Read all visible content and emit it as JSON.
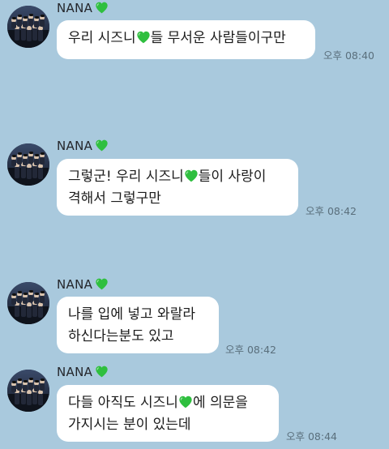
{
  "colors": {
    "background": "#a9c9dd",
    "bubble": "#ffffff",
    "heart": "#2fbf3f"
  },
  "messages": [
    {
      "sender": "NANA",
      "lines": [
        [
          "우리 시즈니",
          "heart",
          "들 무서운 사람들이구만"
        ]
      ],
      "time": "오후 08:40"
    },
    {
      "sender": "NANA",
      "lines": [
        [
          "그렇군! 우리 시즈니",
          "heart",
          "들이 사랑이"
        ],
        [
          "격해서 그렇구만"
        ]
      ],
      "time": "오후 08:42"
    },
    {
      "sender": "NANA",
      "lines": [
        [
          "나를 입에 넣고 와랄라"
        ],
        [
          "하신다는분도 있고"
        ]
      ],
      "time": "오후 08:42"
    },
    {
      "sender": "NANA",
      "lines": [
        [
          "다들 아직도 시즈니",
          "heart",
          "에 의문을"
        ],
        [
          "가지시는 분이 있는데"
        ]
      ],
      "time": "오후 08:44"
    }
  ]
}
